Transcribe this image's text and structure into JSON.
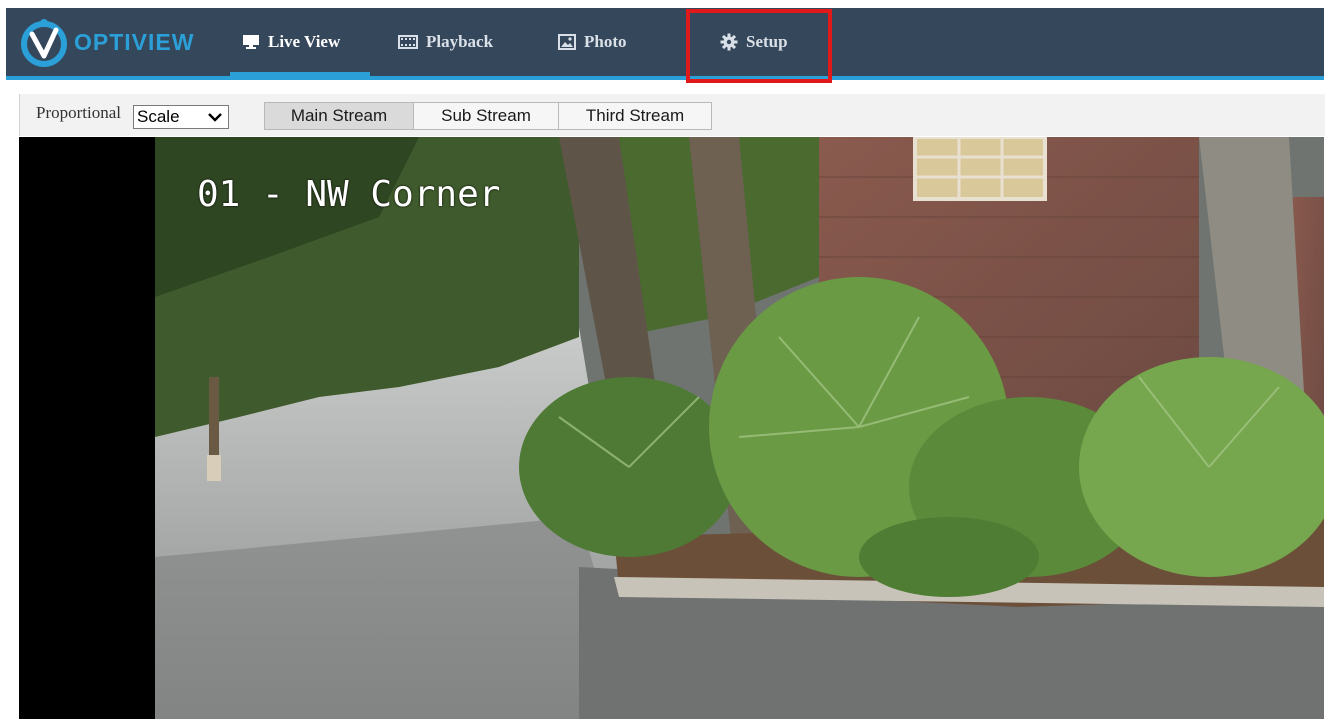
{
  "brand": {
    "name": "OPTIVIEW",
    "color": "#2b9fd8"
  },
  "nav": {
    "items": [
      {
        "label": "Live View",
        "icon": "monitor-icon",
        "active": true
      },
      {
        "label": "Playback",
        "icon": "film-icon",
        "active": false
      },
      {
        "label": "Photo",
        "icon": "photo-icon",
        "active": false
      },
      {
        "label": "Setup",
        "icon": "gear-icon",
        "active": false,
        "highlighted": true
      }
    ]
  },
  "toolbar": {
    "proportional_label": "Proportional",
    "scale_select": {
      "value": "Scale"
    },
    "streams": [
      {
        "label": "Main Stream",
        "selected": true
      },
      {
        "label": "Sub Stream",
        "selected": false
      },
      {
        "label": "Third Stream",
        "selected": false
      }
    ]
  },
  "video": {
    "osd_title": "01 - NW Corner"
  },
  "colors": {
    "topbar": "#35475b",
    "accent": "#2b9fd8",
    "highlight_box": "#e0191a"
  }
}
